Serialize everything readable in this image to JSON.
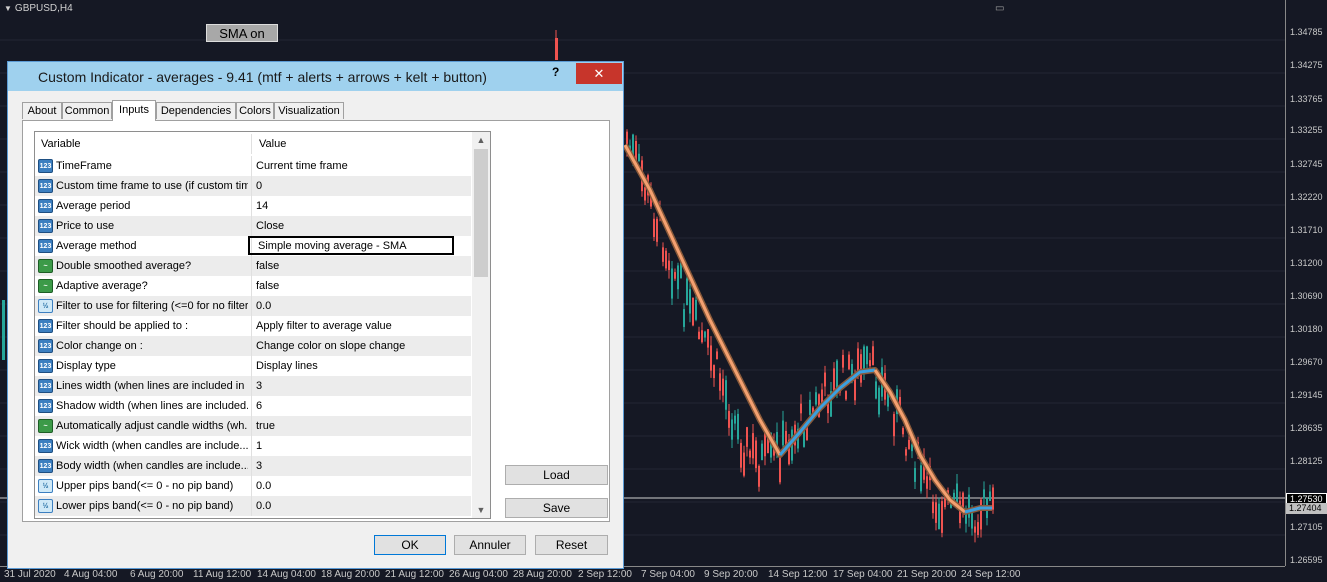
{
  "chart": {
    "symbol": "GBPUSD,H4",
    "sma_button": "SMA on",
    "price_labels": [
      "1.34785",
      "1.34275",
      "1.33765",
      "1.33255",
      "1.32745",
      "1.32220",
      "1.31710",
      "1.31200",
      "1.30690",
      "1.30180",
      "1.29670",
      "1.29145",
      "1.28635",
      "1.28125",
      "1.27530",
      "1.27404",
      "1.27105",
      "1.26595"
    ],
    "current_price_tags": [
      "1.27530",
      "1.27404"
    ],
    "time_labels": [
      "31 Jul 2020",
      "4 Aug 04:00",
      "6 Aug 20:00",
      "11 Aug 12:00",
      "14 Aug 04:00",
      "18 Aug 20:00",
      "21 Aug 12:00",
      "26 Aug 04:00",
      "28 Aug 20:00",
      "2 Sep 12:00",
      "7 Sep 04:00",
      "9 Sep 20:00",
      "14 Sep 12:00",
      "17 Sep 04:00",
      "21 Sep 20:00",
      "24 Sep 12:00"
    ],
    "colors": {
      "bull": "#26a69a",
      "bear": "#ef5350",
      "line_down": "#f4a070",
      "line_up": "#3aa0e0",
      "shadow": "#8a5a3a"
    }
  },
  "dialog": {
    "title": "Custom Indicator - averages - 9.41 (mtf + alerts + arrows + kelt + button)",
    "help": "?",
    "close": "✕",
    "tabs": [
      "About",
      "Common",
      "Inputs",
      "Dependencies",
      "Colors",
      "Visualization"
    ],
    "active_tab": "Inputs",
    "grid": {
      "col_variable": "Variable",
      "col_value": "Value",
      "rows": [
        {
          "icon": "int",
          "name": "TimeFrame",
          "value": "Current time frame"
        },
        {
          "icon": "int",
          "name": "Custom time frame to use (if custom tim...",
          "value": "0"
        },
        {
          "icon": "int",
          "name": "Average period",
          "value": "14"
        },
        {
          "icon": "int",
          "name": "Price to use",
          "value": "Close"
        },
        {
          "icon": "int",
          "name": "Average method",
          "value": "Simple moving average - SMA"
        },
        {
          "icon": "bool",
          "name": "Double smoothed average?",
          "value": "false"
        },
        {
          "icon": "bool",
          "name": "Adaptive average?",
          "value": "false"
        },
        {
          "icon": "dbl",
          "name": "Filter to use for filtering (<=0 for no filteri...",
          "value": "0.0"
        },
        {
          "icon": "int",
          "name": "Filter should be applied to :",
          "value": "Apply filter to average value"
        },
        {
          "icon": "int",
          "name": "Color change on :",
          "value": "Change color on slope change"
        },
        {
          "icon": "int",
          "name": "Display type",
          "value": "Display lines"
        },
        {
          "icon": "int",
          "name": "Lines width (when lines are included in ...",
          "value": "3"
        },
        {
          "icon": "int",
          "name": "Shadow width (when lines are included...",
          "value": "6"
        },
        {
          "icon": "bool",
          "name": "Automatically adjust candle widths (wh...",
          "value": "true"
        },
        {
          "icon": "int",
          "name": "Wick width (when candles are include...",
          "value": "1"
        },
        {
          "icon": "int",
          "name": "Body width (when candles are include...",
          "value": "3"
        },
        {
          "icon": "dbl",
          "name": "Upper pips band(<= 0 - no pip band)",
          "value": "0.0"
        },
        {
          "icon": "dbl",
          "name": "Lower pips band(<= 0 - no pip band)",
          "value": "0.0"
        }
      ],
      "icon_text": {
        "int": "123",
        "bool": "~",
        "dbl": "½"
      }
    },
    "buttons": {
      "load": "Load",
      "save": "Save",
      "ok": "OK",
      "cancel": "Annuler",
      "reset": "Reset"
    }
  }
}
